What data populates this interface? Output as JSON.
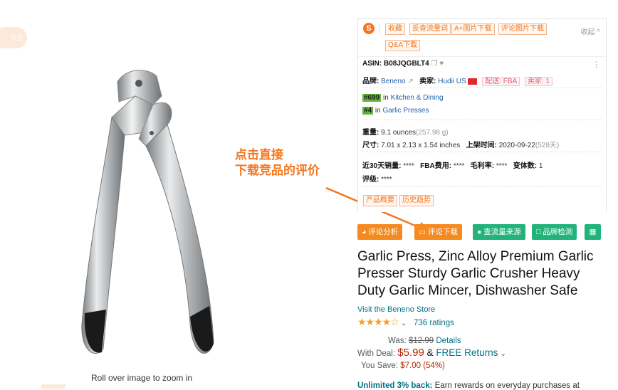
{
  "zoom_badge": "0.0",
  "zoom_hint": "Roll over image to zoom in",
  "annotation": "点击直接\n下载竞品的评价",
  "panel": {
    "logo": "S",
    "tags": [
      "收藏",
      "反查流量词",
      "A+图片下载",
      "评论图片下载",
      "Q&A下载"
    ],
    "collapse": "收起 ^",
    "asin_label": "ASIN: ",
    "asin": "B08JQGBLT4",
    "brand_label": "品牌: ",
    "brand": "Beneno",
    "seller_label": "卖家: ",
    "seller": "Hudii US",
    "fulfillment": "配送: FBA",
    "seller_count": "卖家: 1",
    "rank1_num": "#699",
    "rank1_in": " in ",
    "rank1_cat": "Kitchen & Dining",
    "rank2_num": "#4",
    "rank2_in": " in ",
    "rank2_cat": "Garlic Presses",
    "weight_label": "重量: ",
    "weight": "9.1 ounces",
    "weight_g": "(257.98 g)",
    "size_label": "尺寸: ",
    "size": "7.01 x 2.13 x 1.54 inches",
    "listed_label": "上架时间: ",
    "listed": "2020-09-22",
    "listed_days": "(528天)",
    "sales_label": "近30天销量: ",
    "sales": "****",
    "fba_label": "FBA费用: ",
    "fba": "****",
    "margin_label": "毛利率: ",
    "margin": "****",
    "variants_label": "变体数: ",
    "variants": "1",
    "review_label": "评级: ",
    "review": "****",
    "footer_tags": [
      "产品概要",
      "历史趋势"
    ]
  },
  "actions": {
    "review_analysis": "评论分析",
    "review_download": "评论下载",
    "traffic_source": "查流量来源",
    "brand_check": "品牌检测"
  },
  "product": {
    "title": "Garlic Press, Zinc Alloy Premium Garlic Presser Sturdy Garlic Crusher Heavy Duty Garlic Mincer, Dishwasher Safe",
    "store": "Visit the Beneno Store",
    "stars": "★★★★☆",
    "rating_count": "736 ratings",
    "was_label": "Was: ",
    "was_price": "$12.99",
    "details": "Details",
    "deal_label": "With Deal: ",
    "deal_price": "$5.99",
    "amp": " & ",
    "free_returns": "FREE Returns",
    "save_label": "You Save: ",
    "save_value": "$7.00 (54%)",
    "promo_bold": "Unlimited 3% back:",
    "promo_text": " Earn rewards on everyday purchases at"
  },
  "colors": {
    "accent": "#f58a1f",
    "green": "#21b37a",
    "link": "#007185",
    "price": "#b12704"
  }
}
